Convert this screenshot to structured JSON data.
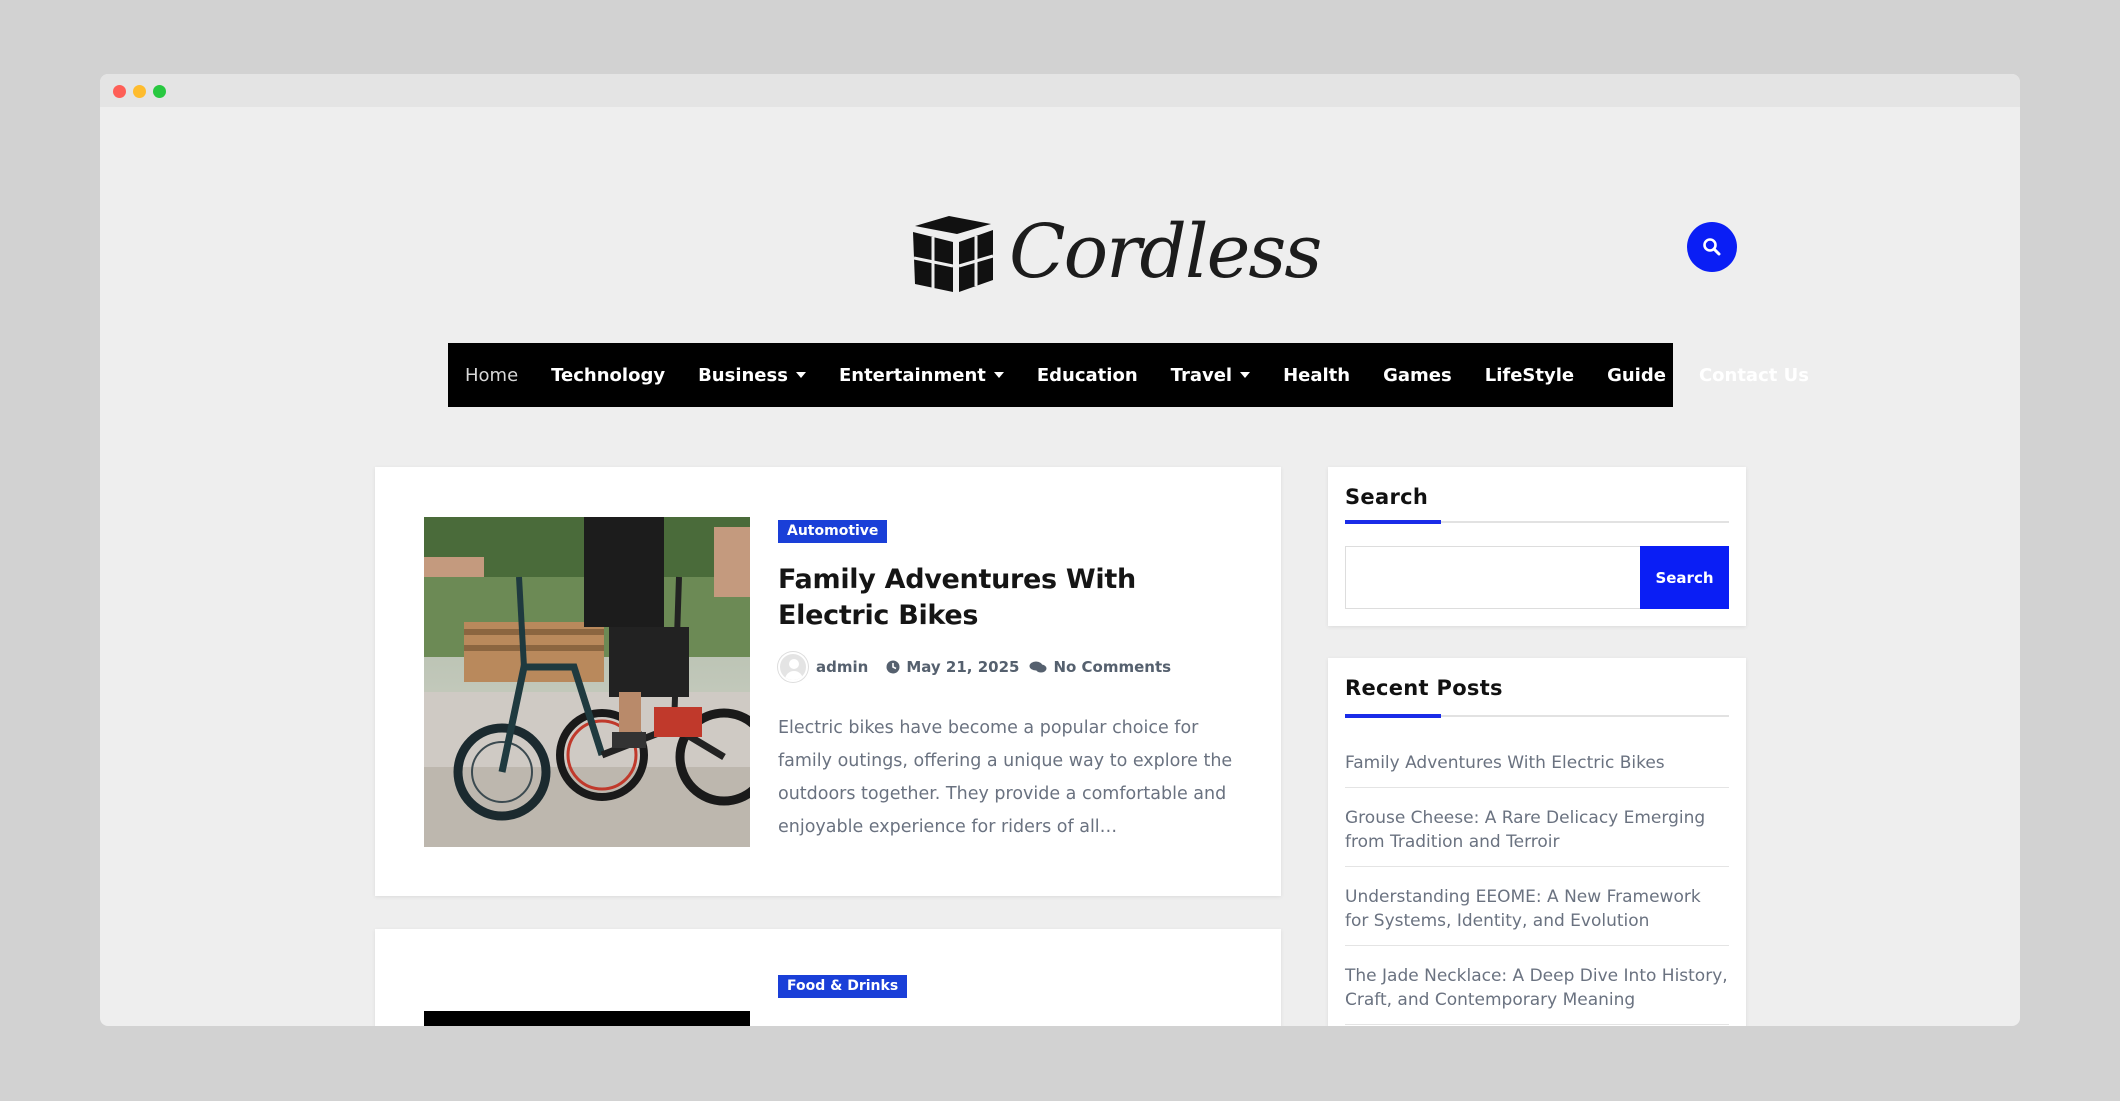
{
  "window": {
    "controls": [
      "close",
      "minimize",
      "maximize"
    ]
  },
  "header": {
    "logo_text": "Cordless",
    "logo_icon": "cube-icon",
    "search_icon": "search-icon",
    "accent_color": "#0a1ef5"
  },
  "nav": {
    "items": [
      {
        "label": "Home",
        "active": true,
        "dropdown": false
      },
      {
        "label": "Technology",
        "dropdown": false
      },
      {
        "label": "Business",
        "dropdown": true
      },
      {
        "label": "Entertainment",
        "dropdown": true
      },
      {
        "label": "Education",
        "dropdown": false
      },
      {
        "label": "Travel",
        "dropdown": true
      },
      {
        "label": "Health",
        "dropdown": false
      },
      {
        "label": "Games",
        "dropdown": false
      },
      {
        "label": "LifeStyle",
        "dropdown": false
      },
      {
        "label": "Guide",
        "dropdown": false
      },
      {
        "label": "Contact Us",
        "dropdown": false
      }
    ]
  },
  "posts": [
    {
      "category": "Automotive",
      "title": "Family Adventures With Electric Bikes",
      "author": "admin",
      "date": "May 21, 2025",
      "comments": "No Comments",
      "excerpt": "Electric bikes have become a popular choice for family outings, offering a unique way to explore the outdoors together. They provide a comfortable and enjoyable experience for riders of all…"
    },
    {
      "category": "Food & Drinks"
    }
  ],
  "sidebar": {
    "search": {
      "title": "Search",
      "button": "Search",
      "placeholder": ""
    },
    "recent": {
      "title": "Recent Posts",
      "items": [
        "Family Adventures With Electric Bikes",
        "Grouse Cheese: A Rare Delicacy Emerging from Tradition and Terroir",
        "Understanding EEOME: A New Framework for Systems, Identity, and Evolution",
        "The Jade Necklace: A Deep Dive Into History, Craft, and Contemporary Meaning"
      ]
    }
  }
}
